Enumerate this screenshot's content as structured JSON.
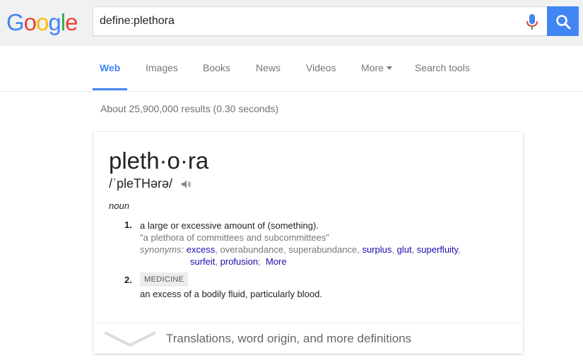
{
  "logo": {
    "letters": [
      "G",
      "o",
      "o",
      "g",
      "l",
      "e"
    ],
    "colors": [
      "#4285f4",
      "#ea4335",
      "#fbbc05",
      "#4285f4",
      "#34a853",
      "#ea4335"
    ]
  },
  "search": {
    "value": "define:plethora"
  },
  "nav": {
    "tabs": [
      {
        "label": "Web",
        "active": true
      },
      {
        "label": "Images"
      },
      {
        "label": "Books"
      },
      {
        "label": "News"
      },
      {
        "label": "Videos"
      },
      {
        "label": "More"
      },
      {
        "label": "Search tools"
      }
    ]
  },
  "stats": "About 25,900,000 results (0.30 seconds)",
  "definition": {
    "word": "pleth·o·ra",
    "pronunciation": "/ˈpleTHərə/",
    "part_of_speech": "noun",
    "senses": [
      {
        "number": "1.",
        "text": "a large or excessive amount of (something).",
        "example": "\"a plethora of committees and subcommittees\"",
        "synonyms_label": "synonyms:",
        "synonyms": [
          {
            "word": "excess",
            "link": true
          },
          {
            "word": "overabundance",
            "link": false
          },
          {
            "word": "superabundance",
            "link": false
          },
          {
            "word": "surplus",
            "link": true
          },
          {
            "word": "glut",
            "link": true
          },
          {
            "word": "superfluity",
            "link": true
          },
          {
            "word": "surfeit",
            "link": true
          },
          {
            "word": "profusion",
            "link": true
          }
        ],
        "more_label": "More"
      },
      {
        "number": "2.",
        "domain": "MEDICINE",
        "text": "an excess of a bodily fluid, particularly blood."
      }
    ],
    "footer": "Translations, word origin, and more definitions"
  },
  "colors": {
    "accent": "#4285f4",
    "link": "#1a0dab",
    "muted": "#777777"
  },
  "icons": [
    "microphone-icon",
    "search-icon",
    "speaker-icon",
    "chevron-down-icon",
    "caret-down-icon"
  ]
}
